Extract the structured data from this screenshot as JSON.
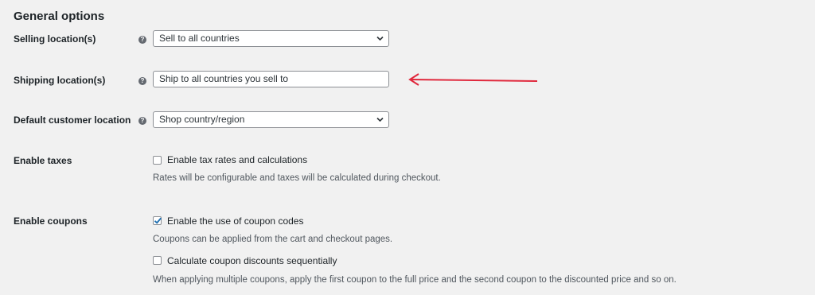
{
  "section": {
    "title": "General options"
  },
  "selling_location": {
    "label": "Selling location(s)",
    "value": "Sell to all countries"
  },
  "shipping_location": {
    "label": "Shipping location(s)",
    "value": "Ship to all countries you sell to"
  },
  "default_customer_location": {
    "label": "Default customer location",
    "value": "Shop country/region"
  },
  "taxes": {
    "label": "Enable taxes",
    "checkbox_label": "Enable tax rates and calculations",
    "checked": false,
    "description": "Rates will be configurable and taxes will be calculated during checkout."
  },
  "coupons": {
    "label": "Enable coupons",
    "checkbox_label": "Enable the use of coupon codes",
    "checked": true,
    "description": "Coupons can be applied from the cart and checkout pages.",
    "sequential_label": "Calculate coupon discounts sequentially",
    "sequential_checked": false,
    "sequential_description": "When applying multiple coupons, apply the first coupon to the full price and the second coupon to the discounted price and so on."
  },
  "help_icon": {
    "glyph": "?"
  },
  "colors": {
    "background": "#f1f1f1",
    "accent": "#2271b1",
    "annotation_arrow": "#e0283c"
  },
  "icons": [
    "help-icon",
    "chevron-down-icon",
    "checkmark-icon",
    "arrow-annotation-icon"
  ]
}
